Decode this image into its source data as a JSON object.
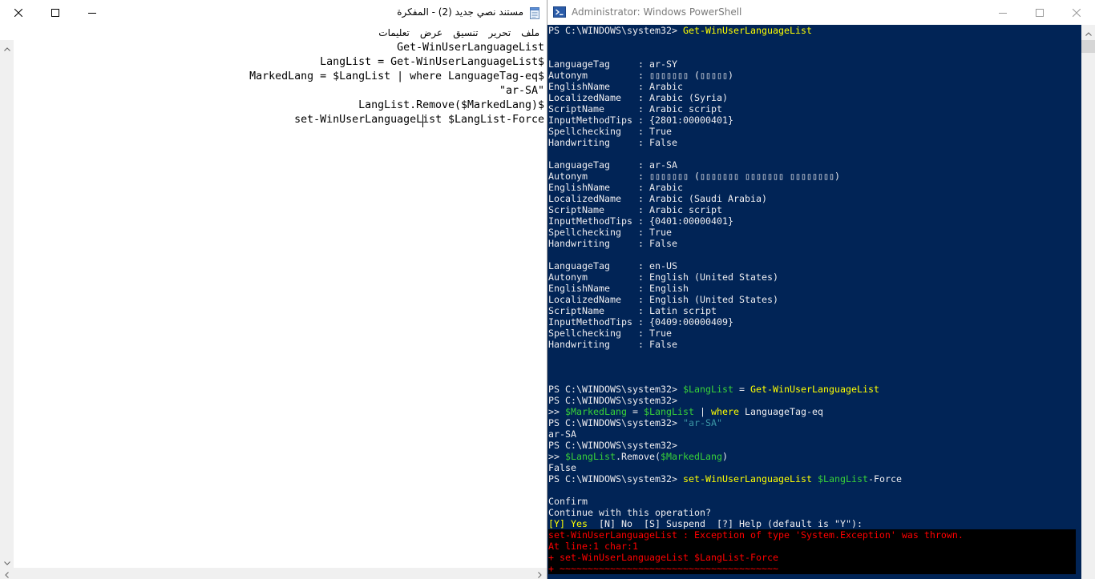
{
  "notepad": {
    "title": "مستند نصي جديد (2) - المفكرة",
    "icons": {
      "app": "notepad-icon",
      "close": "close-icon",
      "maximize": "maximize-icon",
      "minimize": "minimize-icon",
      "scroll_up": "chevron-up-icon",
      "scroll_down": "chevron-down-icon",
      "scroll_left": "chevron-left-icon",
      "scroll_right": "chevron-right-icon"
    },
    "menu": [
      "ملف",
      "تحرير",
      "تنسيق",
      "عرض",
      "تعليمات"
    ],
    "text_lines": [
      "Get-WinUserLanguageList",
      "LangList = Get-WinUserLanguageList$",
      "MarkedLang = $LangList | where LanguageTag-eq$",
      "\"ar-SA\"",
      "LangList.Remove($MarkedLang)$",
      "set-WinUserLanguageList $LangList-Force"
    ]
  },
  "powershell": {
    "title": "Administrator: Windows PowerShell",
    "icons": {
      "app": "powershell-icon",
      "minimize": "minimize-icon",
      "maximize": "maximize-icon",
      "close": "close-icon",
      "scroll_up": "chevron-up-icon"
    },
    "colors": {
      "background": "#012456",
      "text": "#eeedf0",
      "command": "#ffff00",
      "variable": "#38d138",
      "string": "#3c97a6"
    },
    "lines": [
      [
        {
          "t": "PS C:\\WINDOWS\\system32> "
        },
        {
          "t": "Get-WinUserLanguageList",
          "c": "#ffff00"
        }
      ],
      [],
      [],
      [
        {
          "t": "LanguageTag     : ar-SY"
        }
      ],
      [
        {
          "t": "Autonym         : ▯▯▯▯▯▯▯ (▯▯▯▯▯)"
        }
      ],
      [
        {
          "t": "EnglishName     : Arabic"
        }
      ],
      [
        {
          "t": "LocalizedName   : Arabic (Syria)"
        }
      ],
      [
        {
          "t": "ScriptName      : Arabic script"
        }
      ],
      [
        {
          "t": "InputMethodTips : {2801:00000401}"
        }
      ],
      [
        {
          "t": "Spellchecking   : True"
        }
      ],
      [
        {
          "t": "Handwriting     : False"
        }
      ],
      [],
      [
        {
          "t": "LanguageTag     : ar-SA"
        }
      ],
      [
        {
          "t": "Autonym         : ▯▯▯▯▯▯▯ (▯▯▯▯▯▯▯ ▯▯▯▯▯▯▯ ▯▯▯▯▯▯▯▯)"
        }
      ],
      [
        {
          "t": "EnglishName     : Arabic"
        }
      ],
      [
        {
          "t": "LocalizedName   : Arabic (Saudi Arabia)"
        }
      ],
      [
        {
          "t": "ScriptName      : Arabic script"
        }
      ],
      [
        {
          "t": "InputMethodTips : {0401:00000401}"
        }
      ],
      [
        {
          "t": "Spellchecking   : True"
        }
      ],
      [
        {
          "t": "Handwriting     : False"
        }
      ],
      [],
      [
        {
          "t": "LanguageTag     : en-US"
        }
      ],
      [
        {
          "t": "Autonym         : English (United States)"
        }
      ],
      [
        {
          "t": "EnglishName     : English"
        }
      ],
      [
        {
          "t": "LocalizedName   : English (United States)"
        }
      ],
      [
        {
          "t": "ScriptName      : Latin script"
        }
      ],
      [
        {
          "t": "InputMethodTips : {0409:00000409}"
        }
      ],
      [
        {
          "t": "Spellchecking   : True"
        }
      ],
      [
        {
          "t": "Handwriting     : False"
        }
      ],
      [],
      [],
      [],
      [
        {
          "t": "PS C:\\WINDOWS\\system32> "
        },
        {
          "t": "$LangList",
          "c": "#38d138"
        },
        {
          "t": " = "
        },
        {
          "t": "Get-WinUserLanguageList",
          "c": "#ffff00"
        }
      ],
      [
        {
          "t": "PS C:\\WINDOWS\\system32>"
        }
      ],
      [
        {
          "t": ">> "
        },
        {
          "t": "$MarkedLang",
          "c": "#38d138"
        },
        {
          "t": " = "
        },
        {
          "t": "$LangList",
          "c": "#38d138"
        },
        {
          "t": " | "
        },
        {
          "t": "where",
          "c": "#ffff00"
        },
        {
          "t": " LanguageTag-eq"
        }
      ],
      [
        {
          "t": "PS C:\\WINDOWS\\system32> "
        },
        {
          "t": "\"ar-SA\"",
          "c": "#3c97a6"
        }
      ],
      [
        {
          "t": "ar-SA"
        }
      ],
      [
        {
          "t": "PS C:\\WINDOWS\\system32>"
        }
      ],
      [
        {
          "t": ">> "
        },
        {
          "t": "$LangList",
          "c": "#38d138"
        },
        {
          "t": ".Remove("
        },
        {
          "t": "$MarkedLang",
          "c": "#38d138"
        },
        {
          "t": ")"
        }
      ],
      [
        {
          "t": "False"
        }
      ],
      [
        {
          "t": "PS C:\\WINDOWS\\system32> "
        },
        {
          "t": "set-WinUserLanguageList",
          "c": "#ffff00"
        },
        {
          "t": " "
        },
        {
          "t": "$LangList",
          "c": "#38d138"
        },
        {
          "t": "-Force"
        }
      ],
      [],
      [
        {
          "t": "Confirm"
        }
      ],
      [
        {
          "t": "Continue with this operation?"
        }
      ],
      [
        {
          "t": "[Y] Yes",
          "c": "#ffff00"
        },
        {
          "t": "  [N] No  [S] Suspend  [?] Help (default is \"Y\"):"
        }
      ]
    ],
    "error": {
      "background": "#000000",
      "color": "#ff0000",
      "lines": [
        "set-WinUserLanguageList : Exception of type 'System.Exception' was thrown.",
        "At line:1 char:1",
        "+ set-WinUserLanguageList $LangList-Force",
        "+ ~~~~~~~~~~~~~~~~~~~~~~~~~~~~~~~~~~~~~~~"
      ]
    }
  }
}
